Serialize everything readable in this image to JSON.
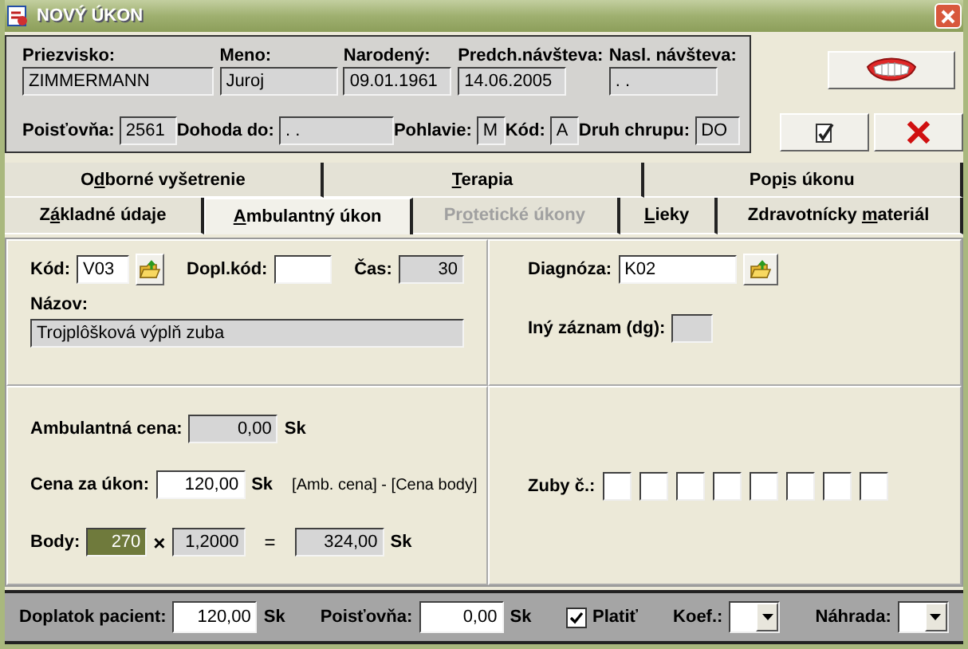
{
  "window": {
    "title": "NOVÝ ÚKON"
  },
  "patient": {
    "row_1": [
      {
        "label": "Priezvisko:",
        "value": "ZIMMERMANN",
        "readonly": true
      },
      {
        "label": "Meno:",
        "value": "Juroj",
        "readonly": true
      },
      {
        "label": "Narodený:",
        "value": "09.01.1961",
        "readonly": true
      },
      {
        "label": "Predch.návšteva:",
        "value": "14.06.2005",
        "readonly": true
      },
      {
        "label": "Nasl. návšteva:",
        "value": ". .",
        "readonly": true
      }
    ],
    "row_2": [
      {
        "label": "Poisťovňa:",
        "value": "2561",
        "readonly": true
      },
      {
        "label": "Dohoda do:",
        "value": ". .",
        "readonly": true
      },
      {
        "label": "Pohlavie:",
        "value": "M",
        "readonly": true
      },
      {
        "label": "Kód:",
        "value": "A",
        "readonly": true
      },
      {
        "label": "Druh chrupu:",
        "value": "DO",
        "readonly": true
      }
    ]
  },
  "header_buttons": [
    {
      "kind": "teeth"
    },
    {
      "kind": "confirm"
    },
    {
      "kind": "cancel"
    }
  ],
  "tabs_top": [
    {
      "label_start": "O",
      "access_key": "d",
      "label_end": "borné vyšetrenie",
      "selected": false,
      "disabled": false
    },
    {
      "access_key": "T",
      "label_end": "erapia",
      "selected": false,
      "disabled": false
    },
    {
      "label_start": "Pop",
      "access_key": "i",
      "label_end": "s úkonu",
      "selected": false,
      "disabled": false
    }
  ],
  "tabs_bottom": [
    {
      "label_start": "Z",
      "access_key": "á",
      "label_end": "kladné údaje",
      "selected": false,
      "disabled": false
    },
    {
      "access_key": "A",
      "label_end": "mbulantný úkon",
      "selected": true,
      "disabled": false
    },
    {
      "label_start": "Pr",
      "access_key": "o",
      "label_end": "tetické úkony",
      "selected": false,
      "disabled": true
    },
    {
      "access_key": "L",
      "label_end": "ieky",
      "selected": false,
      "disabled": false
    },
    {
      "label_start": "Zdravotnícky ",
      "access_key": "m",
      "label_end": "ateriál",
      "selected": false,
      "disabled": false
    }
  ],
  "procedure": {
    "code": {
      "label": "Kód:",
      "value": "V03",
      "readonly": false
    },
    "extra_code": {
      "label": "Dopl.kód:",
      "readonly": false
    },
    "time": {
      "label": "Čas:",
      "value": "30",
      "readonly": true
    },
    "name": {
      "label": "Názov:",
      "value": "Trojplôšková výplň zuba",
      "readonly": true
    }
  },
  "diagnosis": {
    "code": {
      "label": "Diagnóza:",
      "value": "K02",
      "readonly": false
    },
    "other": {
      "label": "Iný záznam (dg):",
      "readonly": true
    }
  },
  "pricing": {
    "ambulant": {
      "label": "Ambulantná cena:",
      "value": "0,00",
      "unit": "Sk",
      "readonly": true
    },
    "price": {
      "label": "Cena za úkon:",
      "value": "120,00",
      "unit": "Sk",
      "readonly": false,
      "note": "[Amb. cena] - [Cena body]"
    },
    "points": {
      "label": "Body:",
      "value": "270",
      "highlighted": true,
      "times": "×",
      "coefficient": "1,2000",
      "equals": "=",
      "result": "324,00",
      "unit": "Sk"
    }
  },
  "teeth": {
    "label": "Zuby č.:"
  },
  "footer": {
    "copay": {
      "label": "Doplatok pacient:",
      "value": "120,00",
      "unit": "Sk"
    },
    "insurance": {
      "label": "Poisťovňa:",
      "value": "0,00",
      "unit": "Sk"
    },
    "pay": {
      "label": "Platiť",
      "checked": true
    },
    "coef": {
      "label": "Koef.:"
    },
    "refund": {
      "label": "Náhrada:"
    }
  }
}
